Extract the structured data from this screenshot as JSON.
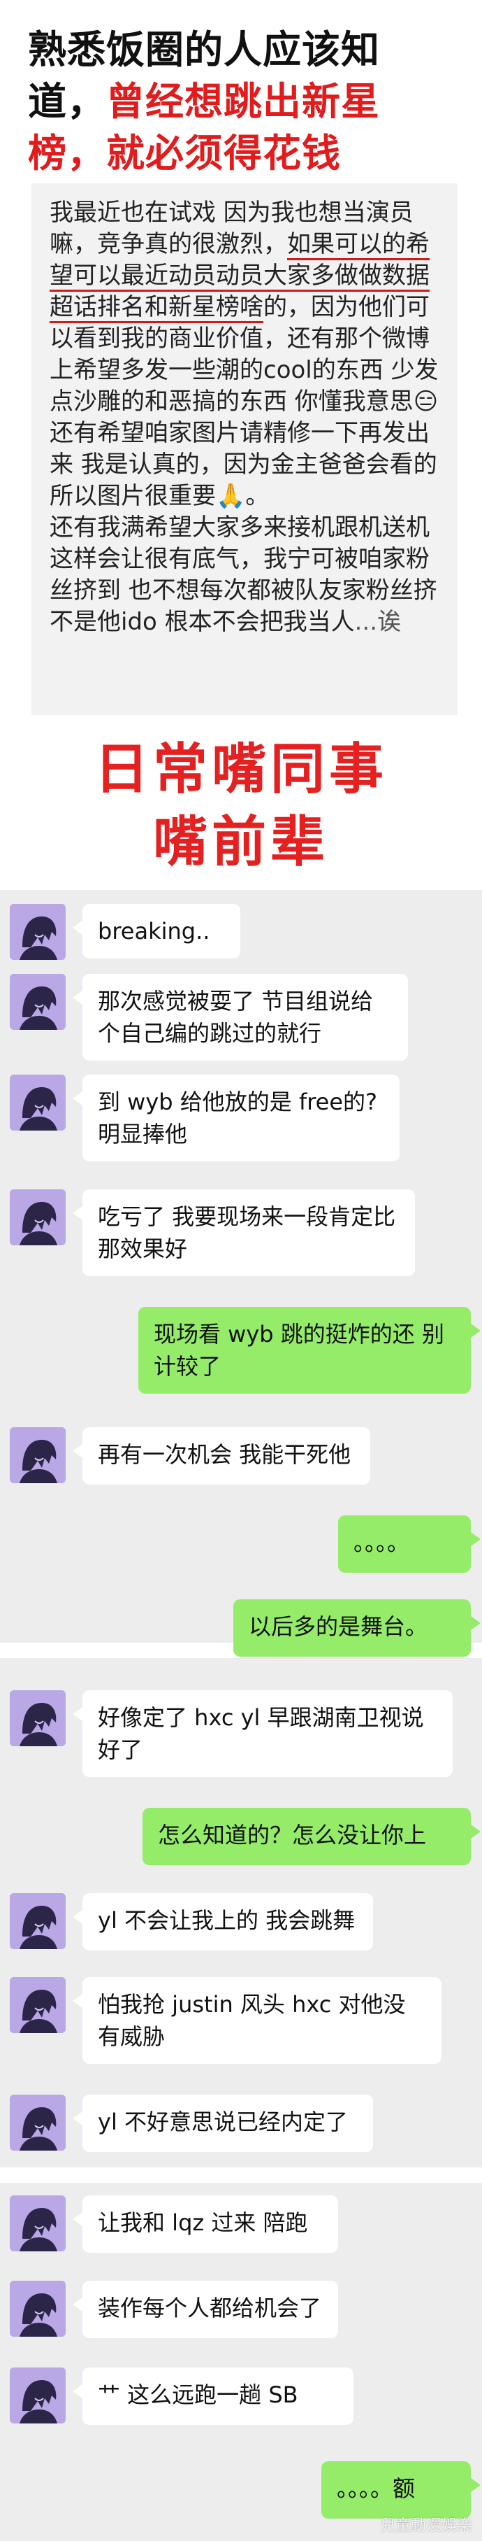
{
  "headline": {
    "line1": "熟悉饭圈的人应该知",
    "line2_plain": "道，",
    "line2_red": "曾经想跳出新星",
    "line3": "榜，就必须得花钱"
  },
  "note": {
    "p1": "我最近也在试戏 因为我也想当演员嘛，竞争真的很激烈，",
    "p1_hl": "如果可以的希望可以最近动员动员大家多做做数据 超话排名和新星榜啥",
    "p1_rest": "的，因为他们可以看到我的商业价值，还有那个微博上希望多发一些潮的cool的东西 少发点沙雕的和恶搞的东西 你懂我意思😑",
    "p2": "还有希望咱家图片请精修一下再发出来 我是认真的，因为金主爸爸会看的 所以图片很重要🙏。",
    "p3": "还有我满希望大家多来接机跟机送机 这样会让很有底气，我宁可被咱家粉丝挤到 也不想每次都被队友家粉丝挤 不是他ido 根本不会把我当人",
    "p3_tail": "...诶"
  },
  "red_title": {
    "line1": "日常嘴同事",
    "line2": "嘴前辈"
  },
  "chat": {
    "msgs": [
      {
        "side": "left",
        "text": "breaking.."
      },
      {
        "side": "left",
        "text": "那次感觉被耍了 节目组说给个自己编的跳过的就行"
      },
      {
        "side": "left",
        "text": "到 wyb 给他放的是 free的?明显捧他"
      },
      {
        "side": "left",
        "text": "吃亏了  我要现场来一段肯定比那效果好"
      },
      {
        "side": "right",
        "text": "现场看 wyb 跳的挺炸的还  别计较了"
      },
      {
        "side": "left",
        "text": "再有一次机会   我能干死他"
      },
      {
        "side": "right",
        "text": "。。。。"
      },
      {
        "side": "right",
        "text": "以后多的是舞台。"
      },
      {
        "side": "left",
        "text": "好像定了 hxc  yl 早跟湖南卫视说好了"
      },
      {
        "side": "right",
        "text": "怎么知道的？怎么没让你上"
      },
      {
        "side": "left",
        "text": "yl 不会让我上的 我会跳舞"
      },
      {
        "side": "left",
        "text": "怕我抢 justin 风头  hxc 对他没有威胁"
      },
      {
        "side": "left",
        "text": "yl 不好意思说已经内定了"
      },
      {
        "side": "left",
        "text": "让我和 lqz 过来  陪跑"
      },
      {
        "side": "left",
        "text": "装作每个人都给机会了"
      },
      {
        "side": "left",
        "text": "艹  这么远跑一趟  SB"
      },
      {
        "side": "right",
        "text": "。。。。额"
      }
    ]
  },
  "watermark": "兒童動漫娛樂",
  "colors": {
    "headline_text": "#111111",
    "accent_red": "#e21c1c",
    "chat_bg": "#ededed",
    "bubble_left": "#ffffff",
    "bubble_right": "#95ec69",
    "avatar_bg": "#b9a7e6"
  }
}
